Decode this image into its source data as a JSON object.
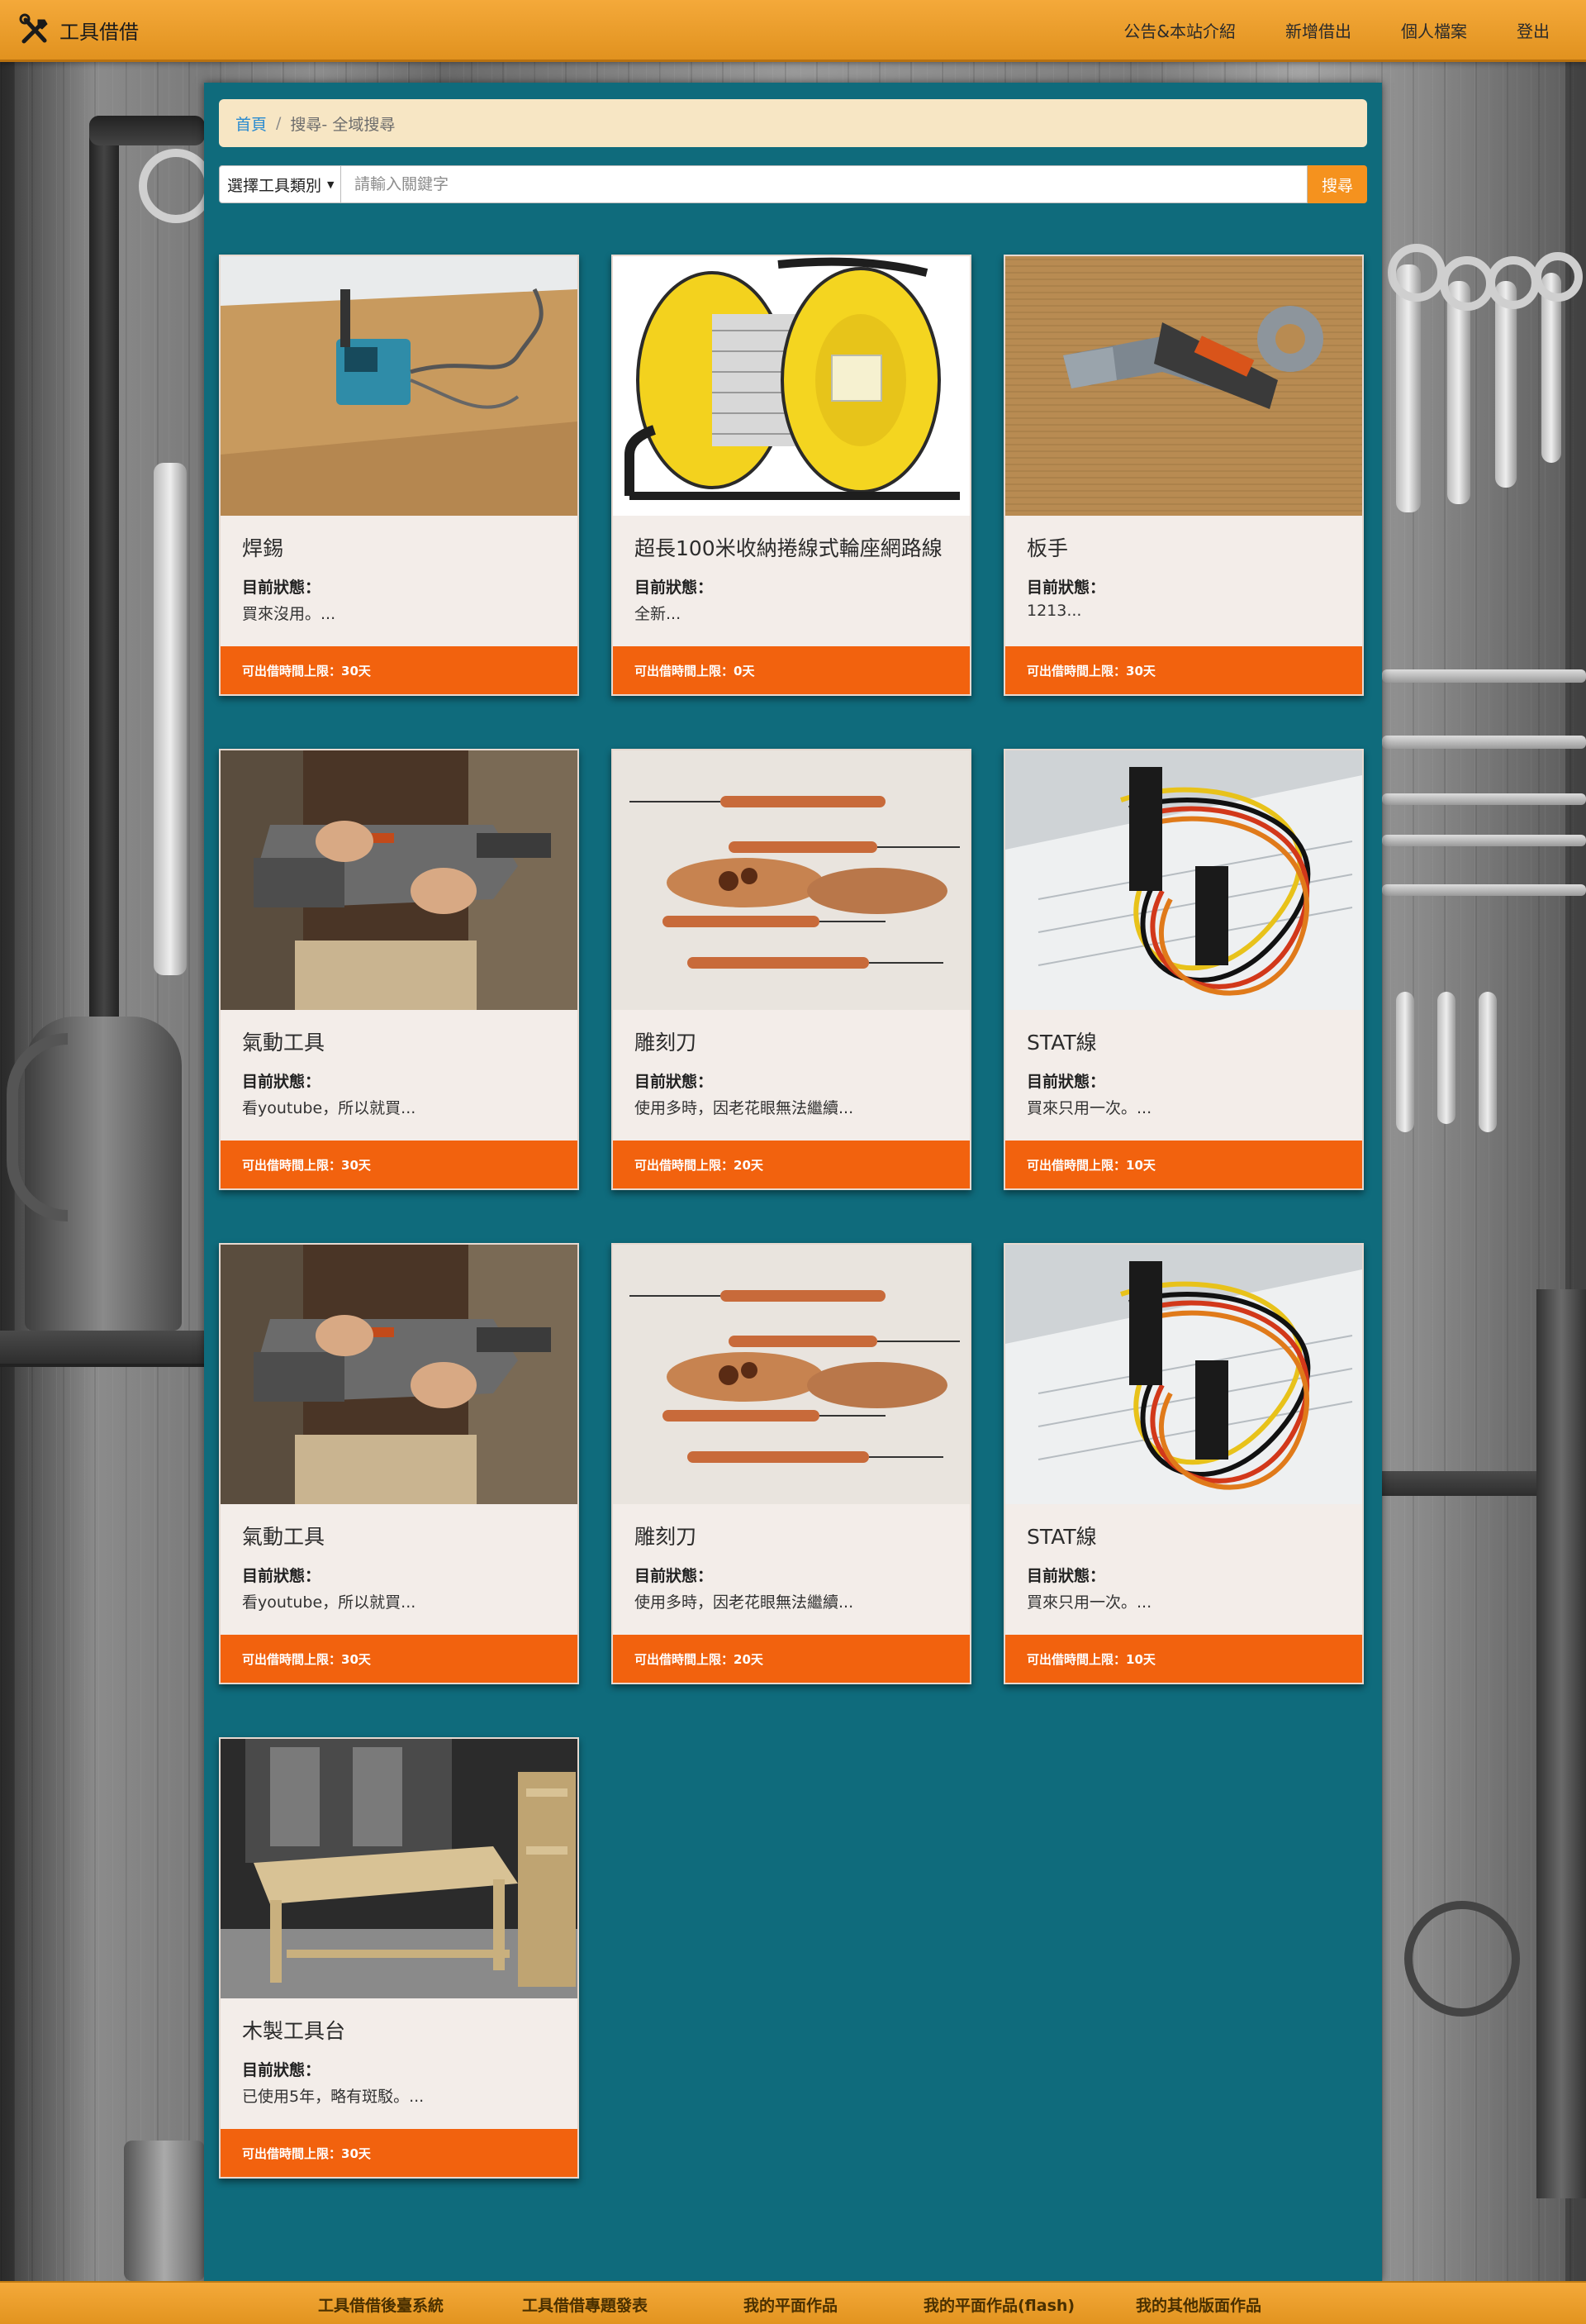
{
  "navbar": {
    "brand": "工具借借",
    "links": [
      "公告&本站介紹",
      "新增借出",
      "個人檔案",
      "登出"
    ]
  },
  "breadcrumb": {
    "home": "首頁",
    "separator": "/",
    "current": "搜尋- 全域搜尋"
  },
  "search": {
    "category_label": "選擇工具類別",
    "placeholder": "請輸入關鍵字",
    "button": "搜尋"
  },
  "status_label": "目前狀態：",
  "cards": [
    {
      "name": "焊錫",
      "status": "買來沒用。...",
      "limit": "可出借時間上限：30天",
      "image": "soldering-station"
    },
    {
      "name": "超長100米收納捲線式輪座網路線",
      "status": "全新...",
      "limit": "可出借時間上限：0天",
      "image": "cable-reel"
    },
    {
      "name": "板手",
      "status": "1213...",
      "limit": "可出借時間上限：30天",
      "image": "adjustable-wrench"
    },
    {
      "name": "氣動工具",
      "status": "看youtube，所以就買...",
      "limit": "可出借時間上限：30天",
      "image": "power-saw"
    },
    {
      "name": "雕刻刀",
      "status": "使用多時，因老花眼無法繼續...",
      "limit": "可出借時間上限：20天",
      "image": "carving-tools"
    },
    {
      "name": "STAT線",
      "status": "買來只用一次。...",
      "limit": "可出借時間上限：10天",
      "image": "sata-cable"
    },
    {
      "name": "氣動工具",
      "status": "看youtube，所以就買...",
      "limit": "可出借時間上限：30天",
      "image": "power-saw"
    },
    {
      "name": "雕刻刀",
      "status": "使用多時，因老花眼無法繼續...",
      "limit": "可出借時間上限：20天",
      "image": "carving-tools"
    },
    {
      "name": "STAT線",
      "status": "買來只用一次。...",
      "limit": "可出借時間上限：10天",
      "image": "sata-cable"
    },
    {
      "name": "木製工具台",
      "status": "已使用5年，略有斑駁。...",
      "limit": "可出借時間上限：30天",
      "image": "wooden-workbench"
    }
  ],
  "footer": {
    "links": [
      "工具借借後臺系統",
      "工具借借專題發表",
      "我的平面作品",
      "我的平面作品(flash)",
      "我的其他版面作品"
    ]
  },
  "colors": {
    "navbar": "#f0a030",
    "panel": "#0f6b7c",
    "breadcrumb_bg": "#f7e6c4",
    "search_button": "#f5921e",
    "card_footer": "#f2620e",
    "card_body": "#f3ede9"
  }
}
